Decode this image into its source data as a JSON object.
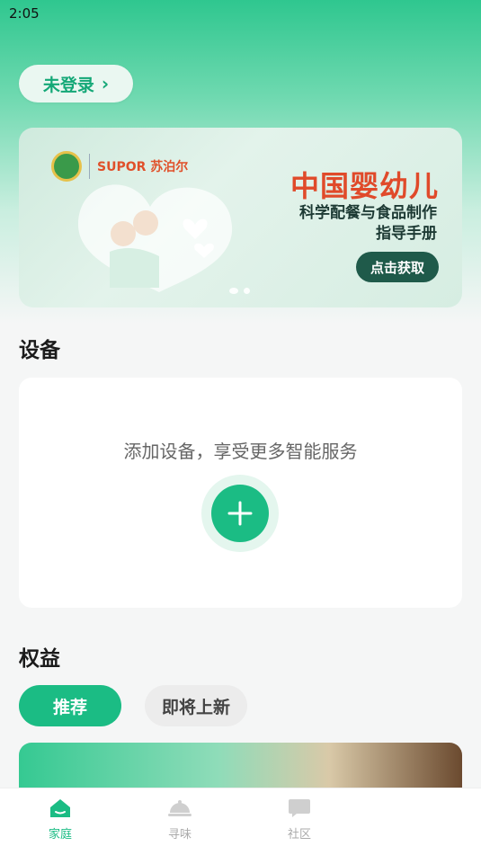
{
  "status_bar": {
    "time": "2:05"
  },
  "header": {
    "login_label": "未登录"
  },
  "banner": {
    "brand": "SUPOR 苏泊尔",
    "title": "中国婴幼儿",
    "subtitle_line1": "科学配餐与食品制作",
    "subtitle_line2": "指导手册",
    "cta_label": "点击获取"
  },
  "devices": {
    "section_title": "设备",
    "empty_text": "添加设备，享受更多智能服务"
  },
  "benefits": {
    "section_title": "权益",
    "tabs": [
      {
        "label": "推荐",
        "active": true
      },
      {
        "label": "即将上新",
        "active": false
      }
    ]
  },
  "bottom_nav": [
    {
      "label": "家庭",
      "icon": "home-icon",
      "active": true
    },
    {
      "label": "寻味",
      "icon": "cloche-icon",
      "active": false
    },
    {
      "label": "社区",
      "icon": "chat-bubble-icon",
      "active": false
    }
  ],
  "colors": {
    "accent": "#1bbc84",
    "banner_title": "#e04a2a"
  }
}
